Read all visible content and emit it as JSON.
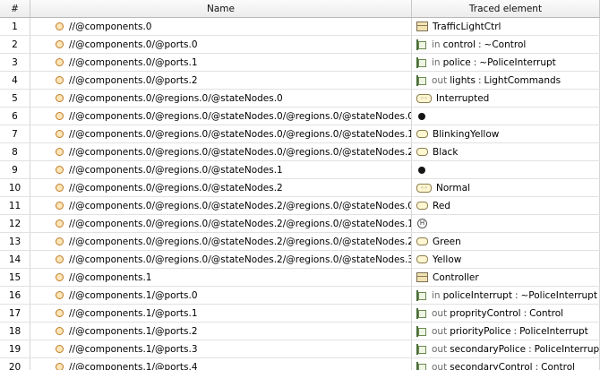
{
  "table": {
    "columns": {
      "num": "#",
      "name": "Name",
      "traced": "Traced element"
    },
    "rows": [
      {
        "num": "1",
        "name": "//@components.0",
        "icon": "component-icon",
        "dir": "",
        "label": "TrafficLightCtrl",
        "type": ""
      },
      {
        "num": "2",
        "name": "//@components.0/@ports.0",
        "icon": "port-icon",
        "dir": "in",
        "label": "control",
        "type": "~Control"
      },
      {
        "num": "3",
        "name": "//@components.0/@ports.1",
        "icon": "port-icon",
        "dir": "in",
        "label": "police",
        "type": "~PoliceInterrupt"
      },
      {
        "num": "4",
        "name": "//@components.0/@ports.2",
        "icon": "port-icon",
        "dir": "out",
        "label": "lights",
        "type": "LightCommands"
      },
      {
        "num": "5",
        "name": "//@components.0/@regions.0/@stateNodes.0",
        "icon": "composite-state-icon",
        "dir": "",
        "label": "Interrupted",
        "type": ""
      },
      {
        "num": "6",
        "name": "//@components.0/@regions.0/@stateNodes.0/@regions.0/@stateNodes.0",
        "icon": "initial-state-icon",
        "dir": "",
        "label": "",
        "type": ""
      },
      {
        "num": "7",
        "name": "//@components.0/@regions.0/@stateNodes.0/@regions.0/@stateNodes.1",
        "icon": "state-icon",
        "dir": "",
        "label": "BlinkingYellow",
        "type": ""
      },
      {
        "num": "8",
        "name": "//@components.0/@regions.0/@stateNodes.0/@regions.0/@stateNodes.2",
        "icon": "state-icon",
        "dir": "",
        "label": "Black",
        "type": ""
      },
      {
        "num": "9",
        "name": "//@components.0/@regions.0/@stateNodes.1",
        "icon": "initial-state-icon",
        "dir": "",
        "label": "",
        "type": ""
      },
      {
        "num": "10",
        "name": "//@components.0/@regions.0/@stateNodes.2",
        "icon": "composite-state-icon",
        "dir": "",
        "label": "Normal",
        "type": ""
      },
      {
        "num": "11",
        "name": "//@components.0/@regions.0/@stateNodes.2/@regions.0/@stateNodes.0",
        "icon": "state-icon",
        "dir": "",
        "label": "Red",
        "type": ""
      },
      {
        "num": "12",
        "name": "//@components.0/@regions.0/@stateNodes.2/@regions.0/@stateNodes.1",
        "icon": "history-state-icon",
        "dir": "",
        "label": "",
        "type": ""
      },
      {
        "num": "13",
        "name": "//@components.0/@regions.0/@stateNodes.2/@regions.0/@stateNodes.2",
        "icon": "state-icon",
        "dir": "",
        "label": "Green",
        "type": ""
      },
      {
        "num": "14",
        "name": "//@components.0/@regions.0/@stateNodes.2/@regions.0/@stateNodes.3",
        "icon": "state-icon",
        "dir": "",
        "label": "Yellow",
        "type": ""
      },
      {
        "num": "15",
        "name": "//@components.1",
        "icon": "component-icon",
        "dir": "",
        "label": "Controller",
        "type": ""
      },
      {
        "num": "16",
        "name": "//@components.1/@ports.0",
        "icon": "port-icon",
        "dir": "in",
        "label": "policeInterrupt",
        "type": "~PoliceInterrupt"
      },
      {
        "num": "17",
        "name": "//@components.1/@ports.1",
        "icon": "port-icon",
        "dir": "out",
        "label": "proprityControl",
        "type": "Control"
      },
      {
        "num": "18",
        "name": "//@components.1/@ports.2",
        "icon": "port-icon",
        "dir": "out",
        "label": "priorityPolice",
        "type": "PoliceInterrupt"
      },
      {
        "num": "19",
        "name": "//@components.1/@ports.3",
        "icon": "port-icon",
        "dir": "out",
        "label": "secondaryPolice",
        "type": "PoliceInterrupt"
      },
      {
        "num": "20",
        "name": "//@components.1/@ports.4",
        "icon": "port-icon",
        "dir": "out",
        "label": "secondaryControl",
        "type": "Control"
      }
    ]
  }
}
